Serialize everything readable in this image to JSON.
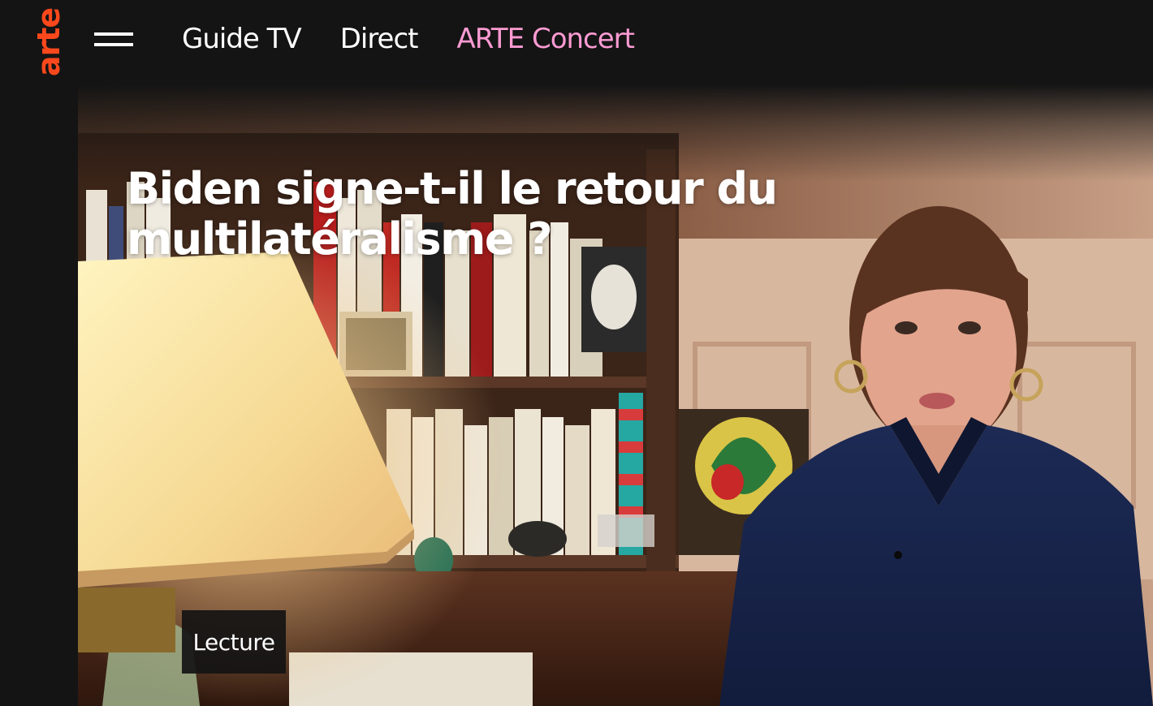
{
  "brand": {
    "logo_text": "arte",
    "logo_color": "#fa481c"
  },
  "nav": {
    "menu_icon": "hamburger-menu-icon",
    "items": [
      {
        "label": "Guide TV"
      },
      {
        "label": "Direct"
      },
      {
        "label": "ARTE Concert",
        "color": "#fc9bd3"
      }
    ]
  },
  "hero": {
    "title": "Biden signe-t-il le retour du multilatéralisme ?",
    "play_label": "Lecture"
  },
  "colors": {
    "background": "#141414",
    "text": "#ffffff",
    "accent_pink": "#fc9bd3"
  }
}
